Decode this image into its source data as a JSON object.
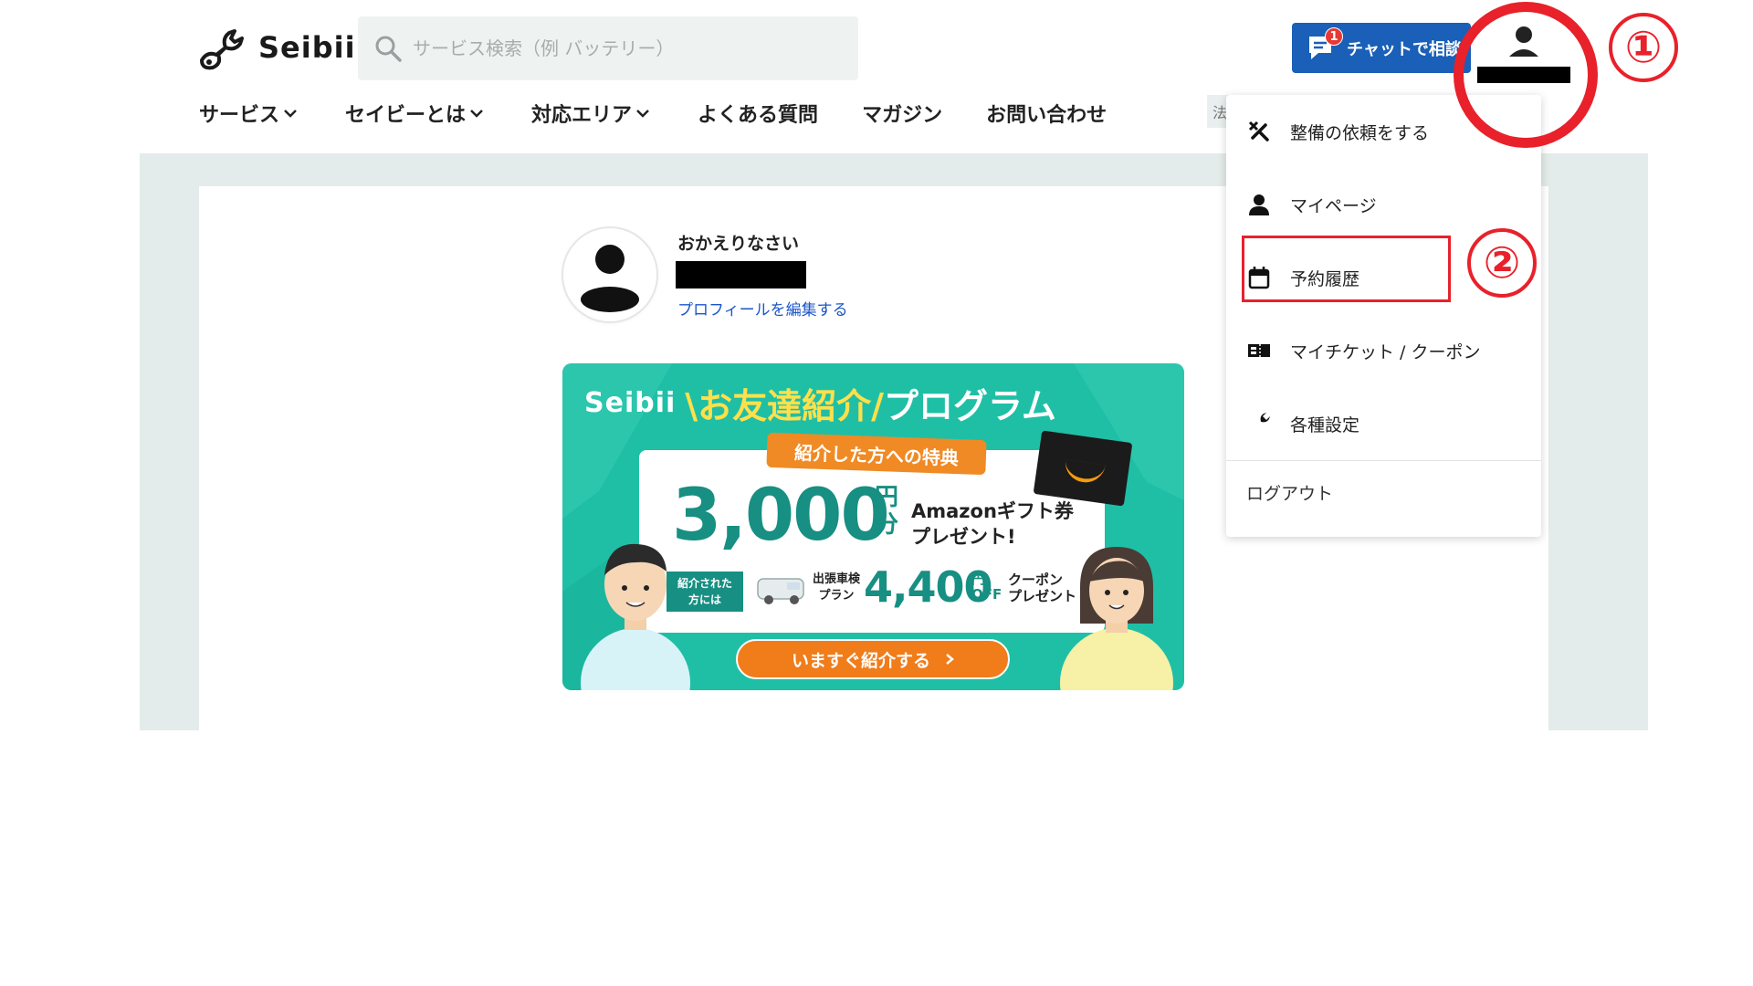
{
  "header": {
    "logo_text": "Seibii",
    "search_placeholder": "サービス検索（例 バッテリー）",
    "chat_button_label": "チャットで相談",
    "chat_badge_count": "1"
  },
  "nav": {
    "items": [
      {
        "label": "サービス",
        "has_dropdown": true
      },
      {
        "label": "セイビーとは",
        "has_dropdown": true
      },
      {
        "label": "対応エリア",
        "has_dropdown": true
      },
      {
        "label": "よくある質問",
        "has_dropdown": false
      },
      {
        "label": "マガジン",
        "has_dropdown": false
      },
      {
        "label": "お問い合わせ",
        "has_dropdown": false
      }
    ],
    "stub_label": "法"
  },
  "annotations": {
    "step1": "①",
    "step2": "②",
    "color": "#e8212a"
  },
  "profile": {
    "welcome": "おかえりなさい",
    "edit_link": "プロフィールを編集する"
  },
  "banner": {
    "logo_text": "Seibii",
    "title_highlight": "\\お友達紹介/",
    "title_rest": "プログラム",
    "ribbon": "紹介した方への特典",
    "amount": "3,000",
    "yen_unit": "円",
    "yen_unit2": "分",
    "gift_line1": "Amazonギフト券",
    "gift_line2": "プレゼント!",
    "referred_line1": "紹介された",
    "referred_line2": "方には",
    "plan_line1": "出張車検",
    "plan_line2": "プラン",
    "amount2": "4,400",
    "off_line1": "円",
    "off_line2": "OFF",
    "coupon_line1": "クーポン",
    "coupon_line2": "プレゼント",
    "cta": "いますぐ紹介する",
    "bg_color": "#1fbfa6",
    "accent_color": "#f07c1a"
  },
  "dropdown": {
    "items": [
      {
        "label": "整備の依頼をする",
        "icon": "tools-icon"
      },
      {
        "label": "マイページ",
        "icon": "person-icon"
      },
      {
        "label": "予約履歴",
        "icon": "calendar-icon"
      },
      {
        "label": "マイチケット / クーポン",
        "icon": "ticket-icon"
      },
      {
        "label": "各種設定",
        "icon": "wrench-icon"
      }
    ],
    "logout": "ログアウト"
  }
}
